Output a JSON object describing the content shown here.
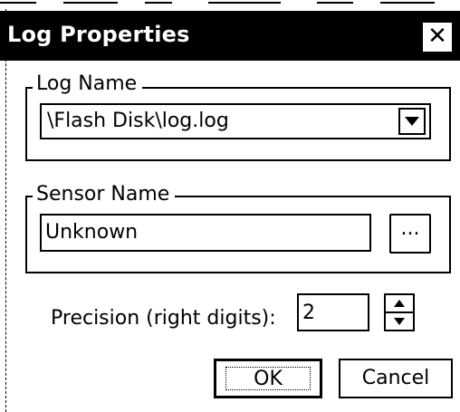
{
  "window": {
    "title": "Log Properties",
    "close_glyph": "✕"
  },
  "log_name": {
    "label": "Log Name",
    "value": "\\Flash Disk\\log.log"
  },
  "sensor_name": {
    "label": "Sensor Name",
    "value": "Unknown",
    "browse_label": "..."
  },
  "precision": {
    "label": "Precision (right digits):",
    "value": "2"
  },
  "buttons": {
    "ok": "OK",
    "cancel": "Cancel"
  },
  "icons": {
    "close": "close-icon",
    "dropdown": "triangle-down-icon",
    "spin_up": "triangle-up-icon",
    "spin_down": "triangle-down-icon"
  },
  "colors": {
    "title_bg": "#000000",
    "title_fg": "#ffffff",
    "background": "#ffffff"
  }
}
